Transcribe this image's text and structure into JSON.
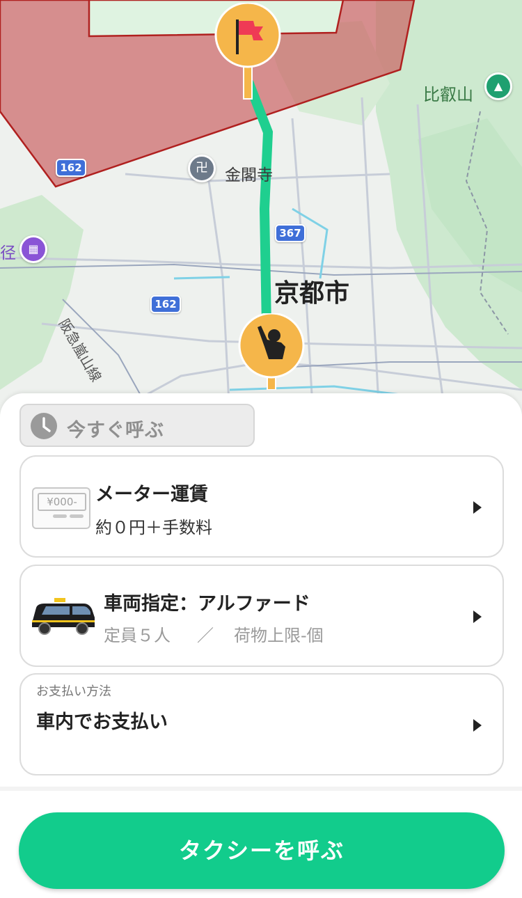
{
  "map": {
    "labels": {
      "city": "京都市",
      "kinkakuji": "金閣寺",
      "hiei": "比叡山",
      "railway": "阪急嵐山線",
      "partial_left": "径"
    },
    "routes": [
      "162",
      "162",
      "367"
    ],
    "icons": {
      "destination_pin": "flag-icon",
      "pickup_pin": "person-hand-raise-icon",
      "temple_icon": "manji-icon",
      "mountain_icon": "mountain-icon",
      "poi_icon": "grid-icon"
    }
  },
  "booking": {
    "time_chip": "今すぐ呼ぶ",
    "fare": {
      "title": "メーター運賃",
      "subtitle": "約０円＋手数料",
      "meter_text": "¥000-"
    },
    "vehicle": {
      "title": "車両指定：アルファード",
      "capacity": "定員５人",
      "separator": "／",
      "luggage": "荷物上限-個"
    },
    "payment": {
      "label": "お支払い方法",
      "value": "車内でお支払い"
    },
    "cta": "タクシーを呼ぶ"
  },
  "colors": {
    "accent": "#12cc8c",
    "route_line": "#1fcf8f",
    "pin": "#f5b64a",
    "zone": "#c9595a"
  }
}
